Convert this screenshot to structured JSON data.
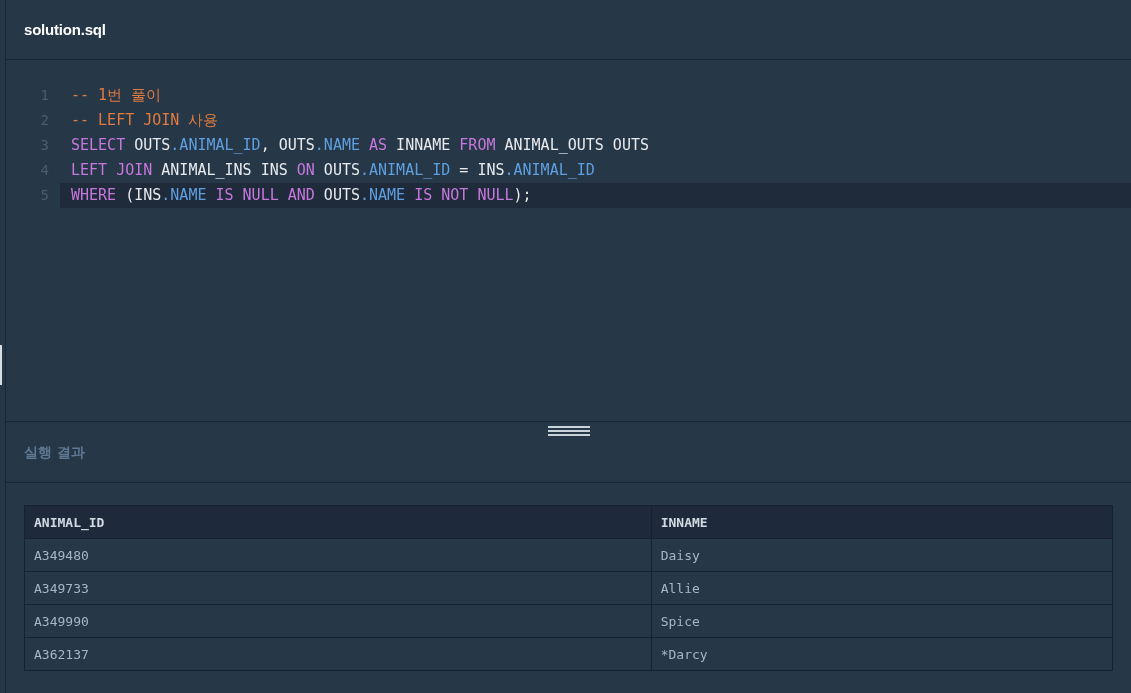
{
  "file_tab": {
    "title": "solution.sql"
  },
  "editor": {
    "lines": [
      {
        "number": "1",
        "active": false,
        "tokens": [
          {
            "kind": "comment",
            "text": "-- 1번 풀이"
          }
        ]
      },
      {
        "number": "2",
        "active": false,
        "tokens": [
          {
            "kind": "comment",
            "text": "-- LEFT JOIN 사용"
          }
        ]
      },
      {
        "number": "3",
        "active": false,
        "tokens": [
          {
            "kind": "keyword",
            "text": "SELECT"
          },
          {
            "kind": "plain",
            "text": " OUTS"
          },
          {
            "kind": "property",
            "text": ".ANIMAL_ID"
          },
          {
            "kind": "plain",
            "text": ", OUTS"
          },
          {
            "kind": "property",
            "text": ".NAME"
          },
          {
            "kind": "keyword",
            "text": " AS"
          },
          {
            "kind": "plain",
            "text": " INNAME "
          },
          {
            "kind": "keyword",
            "text": "FROM"
          },
          {
            "kind": "plain",
            "text": " ANIMAL_OUTS OUTS"
          }
        ]
      },
      {
        "number": "4",
        "active": false,
        "tokens": [
          {
            "kind": "keyword",
            "text": "LEFT JOIN"
          },
          {
            "kind": "plain",
            "text": " ANIMAL_INS INS "
          },
          {
            "kind": "keyword",
            "text": "ON"
          },
          {
            "kind": "plain",
            "text": " OUTS"
          },
          {
            "kind": "property",
            "text": ".ANIMAL_ID"
          },
          {
            "kind": "plain",
            "text": " = INS"
          },
          {
            "kind": "property",
            "text": ".ANIMAL_ID"
          }
        ]
      },
      {
        "number": "5",
        "active": true,
        "tokens": [
          {
            "kind": "keyword",
            "text": "WHERE"
          },
          {
            "kind": "plain",
            "text": " (INS"
          },
          {
            "kind": "property",
            "text": ".NAME"
          },
          {
            "kind": "keyword",
            "text": " IS NULL AND"
          },
          {
            "kind": "plain",
            "text": " OUTS"
          },
          {
            "kind": "property",
            "text": ".NAME"
          },
          {
            "kind": "keyword",
            "text": " IS NOT NULL"
          },
          {
            "kind": "plain",
            "text": ");"
          }
        ]
      }
    ]
  },
  "results": {
    "title": "실행 결과",
    "table": {
      "columns": [
        "ANIMAL_ID",
        "INNAME"
      ],
      "rows": [
        [
          "A349480",
          "Daisy"
        ],
        [
          "A349733",
          "Allie"
        ],
        [
          "A349990",
          "Spice"
        ],
        [
          "A362137",
          "*Darcy"
        ]
      ]
    }
  }
}
